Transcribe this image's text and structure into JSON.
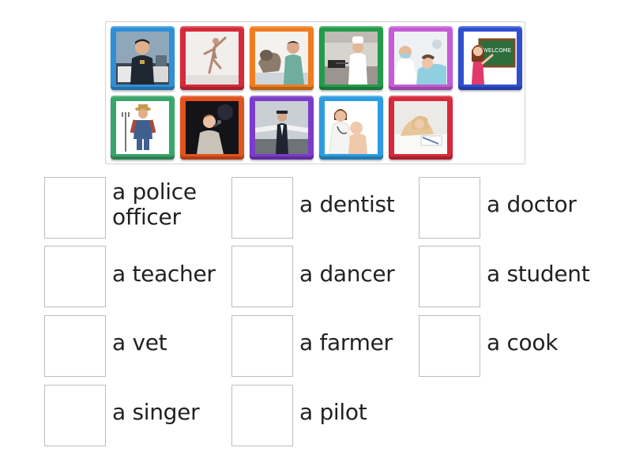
{
  "tiles": [
    {
      "icon": "police-officer-photo-icon",
      "color": "#2f8fd8"
    },
    {
      "icon": "dancer-photo-icon",
      "color": "#d72a3a"
    },
    {
      "icon": "vet-photo-icon",
      "color": "#ef7d1f"
    },
    {
      "icon": "cook-photo-icon",
      "color": "#239a4c"
    },
    {
      "icon": "dentist-photo-icon",
      "color": "#c55bd6"
    },
    {
      "icon": "teacher-photo-icon",
      "color": "#2f4fd0"
    },
    {
      "icon": "farmer-photo-icon",
      "color": "#3aa66a"
    },
    {
      "icon": "singer-photo-icon",
      "color": "#e2521f"
    },
    {
      "icon": "pilot-photo-icon",
      "color": "#7c3cc9"
    },
    {
      "icon": "doctor-photo-icon",
      "color": "#2d9ce0"
    },
    {
      "icon": "student-photo-icon",
      "color": "#d8293a"
    }
  ],
  "teacher_board_text": "WELCOME",
  "targets": [
    {
      "label": "a police\nofficer"
    },
    {
      "label": "a dentist"
    },
    {
      "label": "a doctor"
    },
    {
      "label": "a teacher"
    },
    {
      "label": "a dancer"
    },
    {
      "label": "a student"
    },
    {
      "label": "a vet"
    },
    {
      "label": "a farmer"
    },
    {
      "label": "a cook"
    },
    {
      "label": "a singer"
    },
    {
      "label": "a pilot"
    }
  ]
}
